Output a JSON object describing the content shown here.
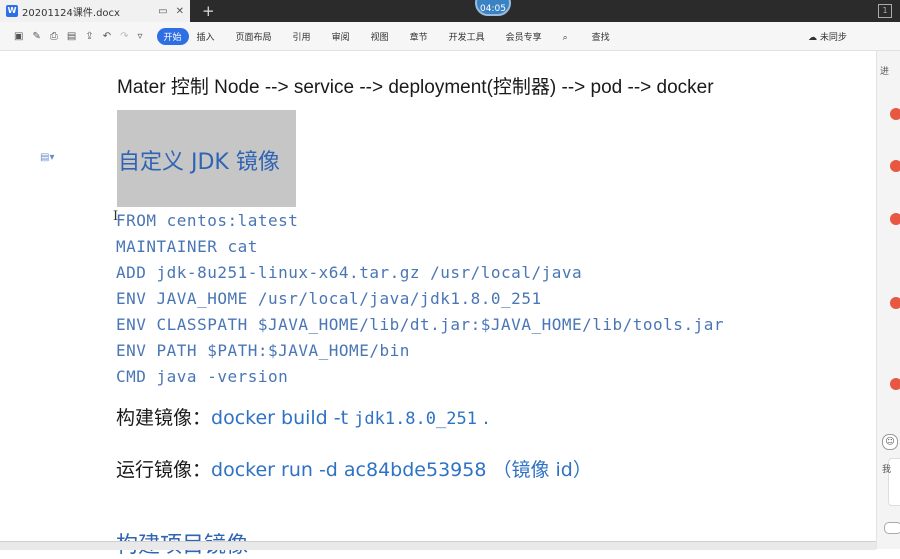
{
  "tab": {
    "filename": "20201124课件.docx",
    "app_letter": "W"
  },
  "timer": "04:05",
  "toolbar": {
    "start": "开始",
    "menus": [
      "插入",
      "页面布局",
      "引用",
      "审阅",
      "视图",
      "章节",
      "开发工具",
      "会员专享"
    ],
    "search": "查找",
    "sync": "未同步"
  },
  "doc": {
    "line1": "Mater 控制 Node --> service --> deployment(控制器) --> pod --> docker",
    "heading": "自定义 JDK 镜像",
    "code": [
      "FROM centos:latest",
      "MAINTAINER cat",
      "ADD jdk-8u251-linux-x64.tar.gz /usr/local/java",
      "ENV JAVA_HOME /usr/local/java/jdk1.8.0_251",
      "ENV CLASSPATH $JAVA_HOME/lib/dt.jar:$JAVA_HOME/lib/tools.jar",
      "ENV PATH $PATH:$JAVA_HOME/bin",
      "CMD java -version"
    ],
    "build": {
      "label": "构建镜像：",
      "cmd": "docker build -t ",
      "tag": "jdk1.8.0_251",
      "tail": " ."
    },
    "run": {
      "label": "运行镜像：",
      "cmd": "docker run -d ac84bde53958 （镜像 id）"
    },
    "next_heading": "构建项目镜像"
  },
  "rail": {
    "note": "进",
    "small": "我"
  },
  "colors": {
    "accent": "#2f6fe4",
    "heading": "#2f64b4",
    "code": "#4a76b6",
    "highlight": "#c6c6c6"
  }
}
